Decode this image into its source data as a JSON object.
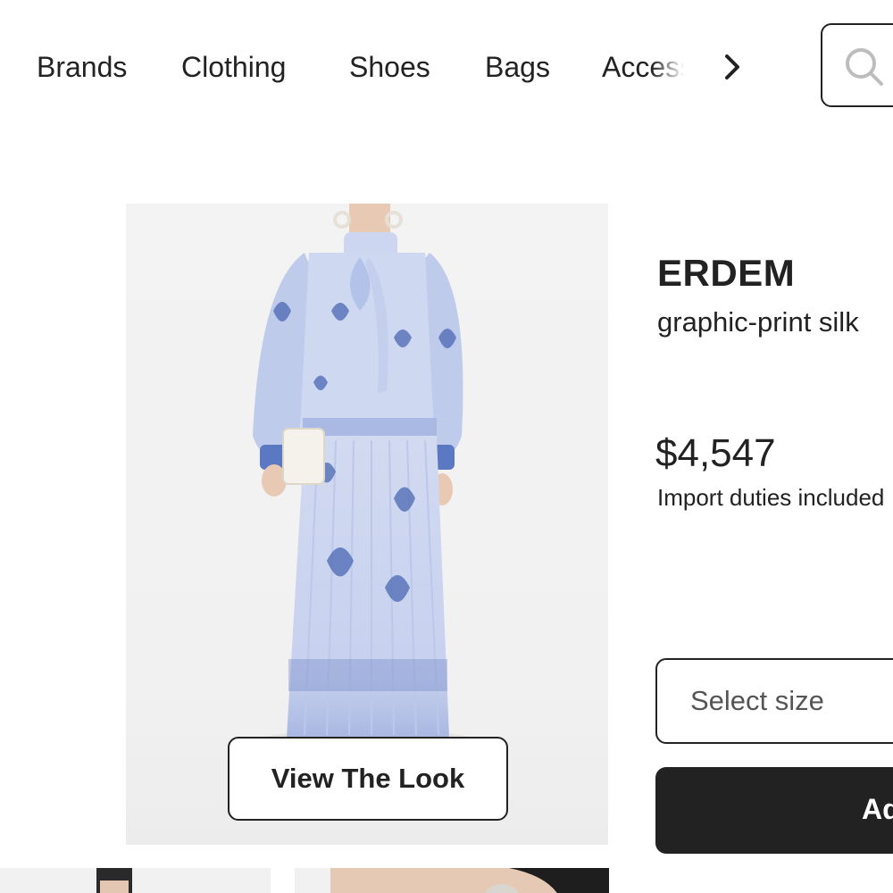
{
  "nav": {
    "items": [
      {
        "label": "Brands"
      },
      {
        "label": "Clothing"
      },
      {
        "label": "Shoes"
      },
      {
        "label": "Bags"
      },
      {
        "label": "Accessories"
      }
    ],
    "next_icon": "chevron-right-icon"
  },
  "search": {
    "icon": "search-icon"
  },
  "gallery": {
    "view_look_label": "View The Look"
  },
  "product": {
    "brand": "ERDEM",
    "name": "graphic-print silk",
    "price": "$4,547",
    "duties_note": "Import duties included"
  },
  "size_select": {
    "placeholder": "Select size"
  },
  "add_button": {
    "label": "Add"
  },
  "colors": {
    "text": "#222222",
    "button_dark": "#222222",
    "image_bg": "#f1f1f1",
    "dress_light": "#c9d3ee",
    "dress_print": "#4b68b3"
  }
}
